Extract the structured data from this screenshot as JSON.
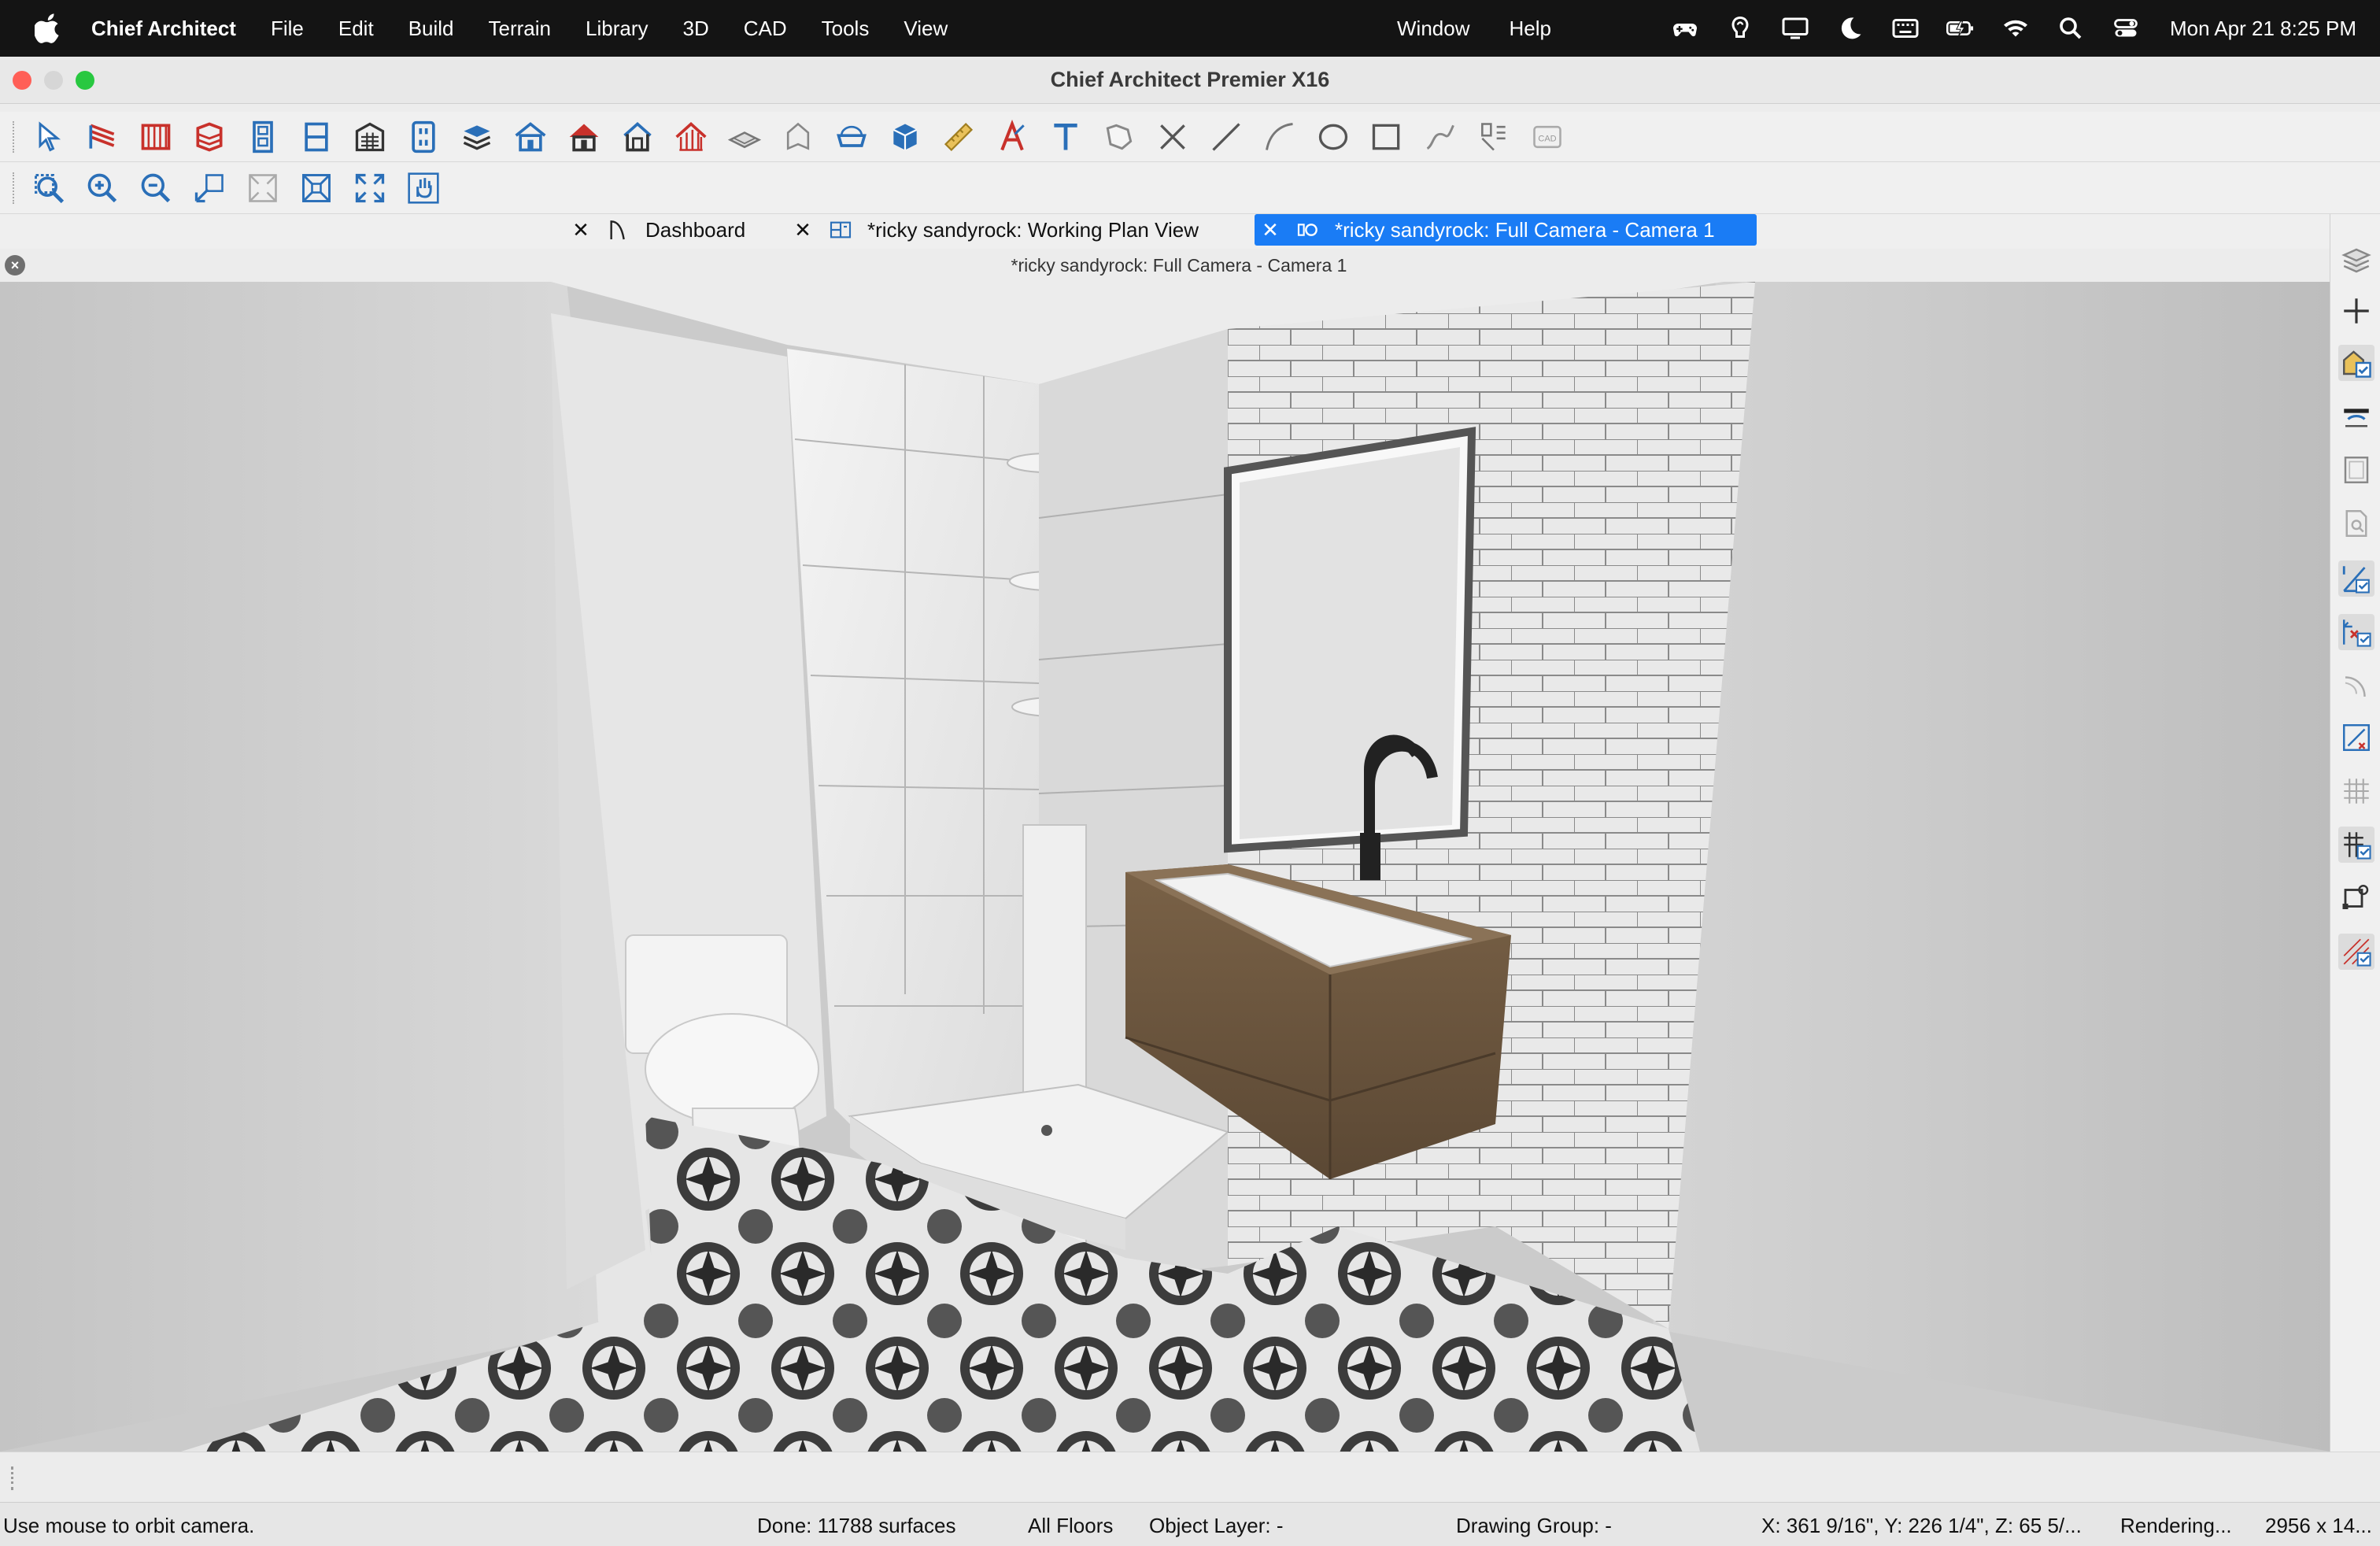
{
  "menubar": {
    "app_name": "Chief Architect",
    "menus": [
      "File",
      "Edit",
      "Build",
      "Terrain",
      "Library",
      "3D",
      "CAD",
      "Tools",
      "View"
    ],
    "right_menus": [
      "Window",
      "Help"
    ],
    "status_icons": [
      "gamepad-icon",
      "location-icon",
      "display-icon",
      "moon-icon",
      "keyboard-icon",
      "battery-icon",
      "wifi-icon",
      "search-icon",
      "control-center-icon"
    ],
    "clock": "Mon Apr 21  8:25 PM"
  },
  "window": {
    "title": "Chief Architect Premier X16"
  },
  "tabs": [
    {
      "label": "Dashboard",
      "icon": "dashboard-icon",
      "active": false
    },
    {
      "label": "*ricky sandyrock:  Working Plan View",
      "icon": "plan-view-icon",
      "active": false
    },
    {
      "label": "*ricky sandyrock: Full Camera - Camera 1",
      "icon": "camera-icon",
      "active": true
    }
  ],
  "view": {
    "title": "*ricky sandyrock: Full Camera - Camera 1"
  },
  "statusbar": {
    "hint": "Use mouse to orbit camera.",
    "done": "Done:  11788 surfaces",
    "floors": "All Floors",
    "object_layer": "Object Layer: -",
    "drawing_group": "Drawing Group: -",
    "coords": "X: 361 9/16\", Y: 226 1/4\", Z: 65 5/...",
    "rendering": "Rendering...",
    "size": "2956 x 14..."
  },
  "colors": {
    "active_tab": "#1a7cf5",
    "menubar_bg": "#141414",
    "icon_blue": "#2a6fb8",
    "icon_red": "#c8312b"
  }
}
